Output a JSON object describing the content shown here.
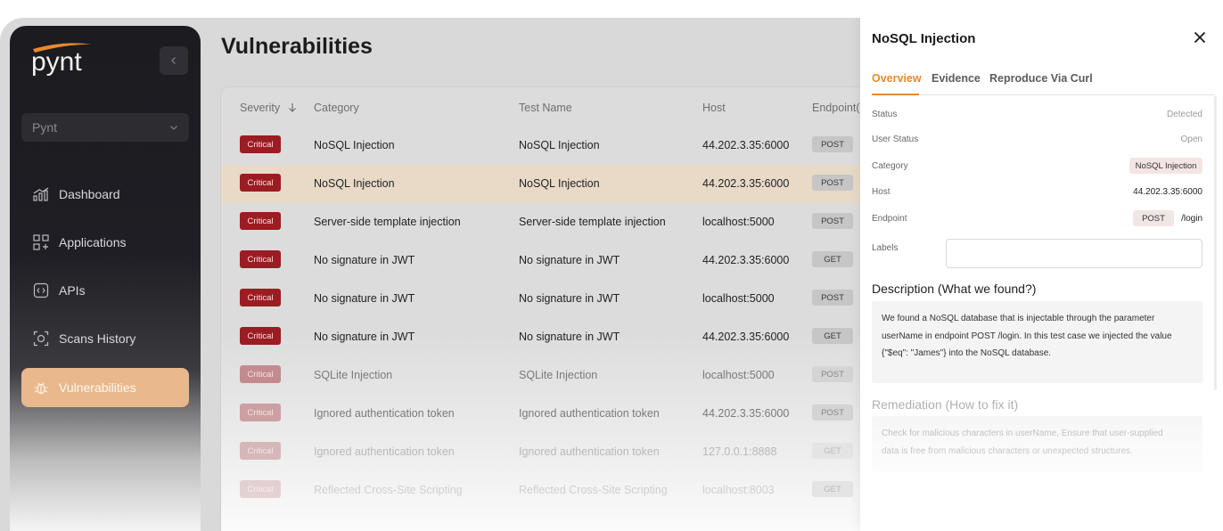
{
  "sidebar": {
    "logo_text": "pynt",
    "org_select": {
      "value": "Pynt"
    },
    "nav": [
      {
        "label": "Dashboard",
        "icon": "dashboard-chart-icon"
      },
      {
        "label": "Applications",
        "icon": "applications-grid-icon"
      },
      {
        "label": "APIs",
        "icon": "api-code-icon"
      },
      {
        "label": "Scans History",
        "icon": "scan-icon"
      },
      {
        "label": "Vulnerabilities",
        "icon": "bug-icon",
        "active": true
      }
    ]
  },
  "main": {
    "title": "Vulnerabilities",
    "table": {
      "headers": {
        "severity": "Severity",
        "category": "Category",
        "test_name": "Test Name",
        "host": "Host",
        "endpoint": "Endpoint("
      },
      "rows": [
        {
          "severity": "Critical",
          "category": "NoSQL Injection",
          "test_name": "NoSQL Injection",
          "host": "44.202.3.35:6000",
          "method": "POST"
        },
        {
          "severity": "Critical",
          "category": "NoSQL Injection",
          "test_name": "NoSQL Injection",
          "host": "44.202.3.35:6000",
          "method": "POST",
          "selected": true
        },
        {
          "severity": "Critical",
          "category": "Server-side template injection",
          "test_name": "Server-side template injection",
          "host": "localhost:5000",
          "method": "POST"
        },
        {
          "severity": "Critical",
          "category": "No signature in JWT",
          "test_name": "No signature in JWT",
          "host": "44.202.3.35:6000",
          "method": "GET"
        },
        {
          "severity": "Critical",
          "category": "No signature in JWT",
          "test_name": "No signature in JWT",
          "host": "localhost:5000",
          "method": "POST"
        },
        {
          "severity": "Critical",
          "category": "No signature in JWT",
          "test_name": "No signature in JWT",
          "host": "44.202.3.35:6000",
          "method": "GET"
        },
        {
          "severity": "Critical",
          "category": "SQLite Injection",
          "test_name": "SQLite Injection",
          "host": "localhost:5000",
          "method": "POST"
        },
        {
          "severity": "Critical",
          "category": "Ignored authentication token",
          "test_name": "Ignored authentication token",
          "host": "44.202.3.35:6000",
          "method": "POST"
        },
        {
          "severity": "Critical",
          "category": "Ignored authentication token",
          "test_name": "Ignored authentication token",
          "host": "127.0.0.1:8888",
          "method": "GET"
        },
        {
          "severity": "Critical",
          "category": "Reflected Cross-Site Scripting",
          "test_name": "Reflected Cross-Site Scripting",
          "host": "localhost:8003",
          "method": "GET"
        }
      ]
    }
  },
  "panel": {
    "title": "NoSQL Injection",
    "tabs": [
      "Overview",
      "Evidence",
      "Reproduce Via Curl"
    ],
    "fields": {
      "status": {
        "label": "Status",
        "value": "Detected"
      },
      "user_status": {
        "label": "User Status",
        "value": "Open"
      },
      "category": {
        "label": "Category",
        "value": "NoSQL Injection"
      },
      "host": {
        "label": "Host",
        "value": "44.202.3.35:6000"
      },
      "endpoint": {
        "label": "Endpoint",
        "method": "POST",
        "path": "/login"
      },
      "labels": {
        "label": "Labels",
        "value": ""
      }
    },
    "description": {
      "heading": "Description (What we found?)",
      "lines": [
        "We found a NoSQL database that is injectable through the parameter",
        "userName in endpoint POST /login. In this test case we injected the value",
        "{\"$eq\": \"James\"} into the NoSQL database."
      ]
    },
    "remediation": {
      "heading": "Remediation (How to fix it)",
      "lines": [
        "Check for malicious characters in userName, Ensure that user-supplied",
        "data is free from malicious characters or unexpected structures."
      ]
    }
  },
  "colors": {
    "accent": "#e8892e",
    "critical": "#9b1c22",
    "active_nav": "#e9b98d"
  }
}
